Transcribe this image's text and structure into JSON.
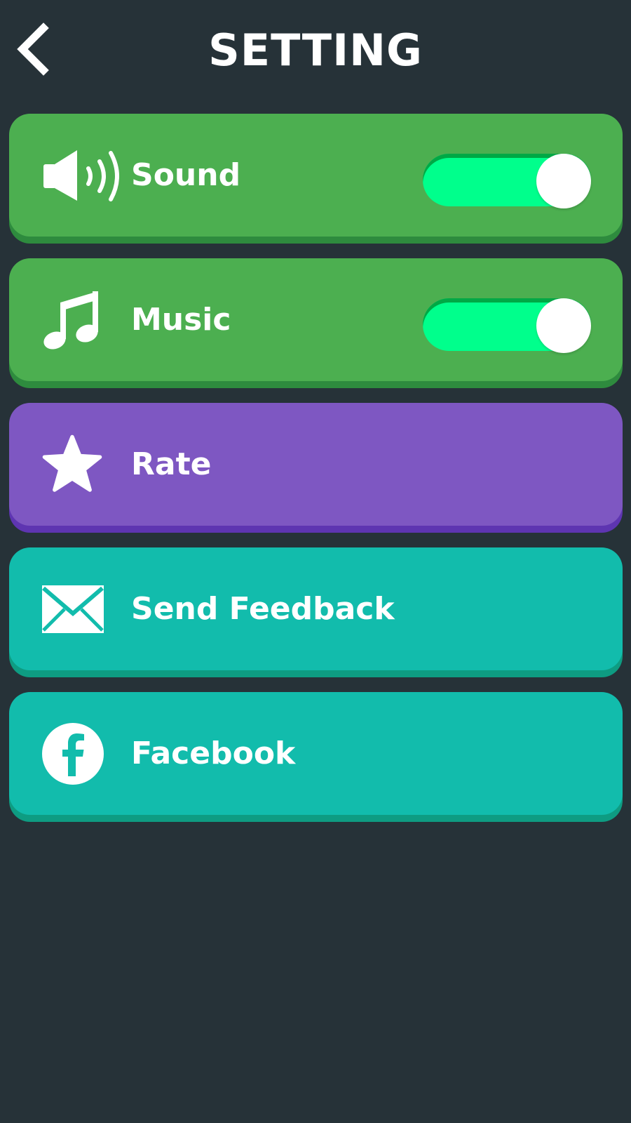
{
  "header": {
    "title": "SETTING",
    "back_icon": "chevron-left-icon"
  },
  "colors": {
    "background": "#263238",
    "green_row": "#4CAF50",
    "green_row_shadow": "#2E8B3E",
    "purple_row": "#7E57C2",
    "purple_row_shadow": "#5E35B1",
    "teal_row": "#12BCAC",
    "teal_row_shadow": "#0E9C82",
    "toggle_on": "#00FF8C",
    "toggle_track_edge": "#00A845",
    "text": "#FFFFFF"
  },
  "settings": [
    {
      "id": "sound",
      "label": "Sound",
      "icon": "speaker-icon",
      "color": "green",
      "has_toggle": true,
      "toggle_on": true
    },
    {
      "id": "music",
      "label": "Music",
      "icon": "music-note-icon",
      "color": "green",
      "has_toggle": true,
      "toggle_on": true
    },
    {
      "id": "rate",
      "label": "Rate",
      "icon": "star-icon",
      "color": "purple",
      "has_toggle": false
    },
    {
      "id": "feedback",
      "label": "Send Feedback",
      "icon": "envelope-icon",
      "color": "teal",
      "has_toggle": false
    },
    {
      "id": "facebook",
      "label": "Facebook",
      "icon": "facebook-icon",
      "color": "teal",
      "has_toggle": false
    }
  ]
}
